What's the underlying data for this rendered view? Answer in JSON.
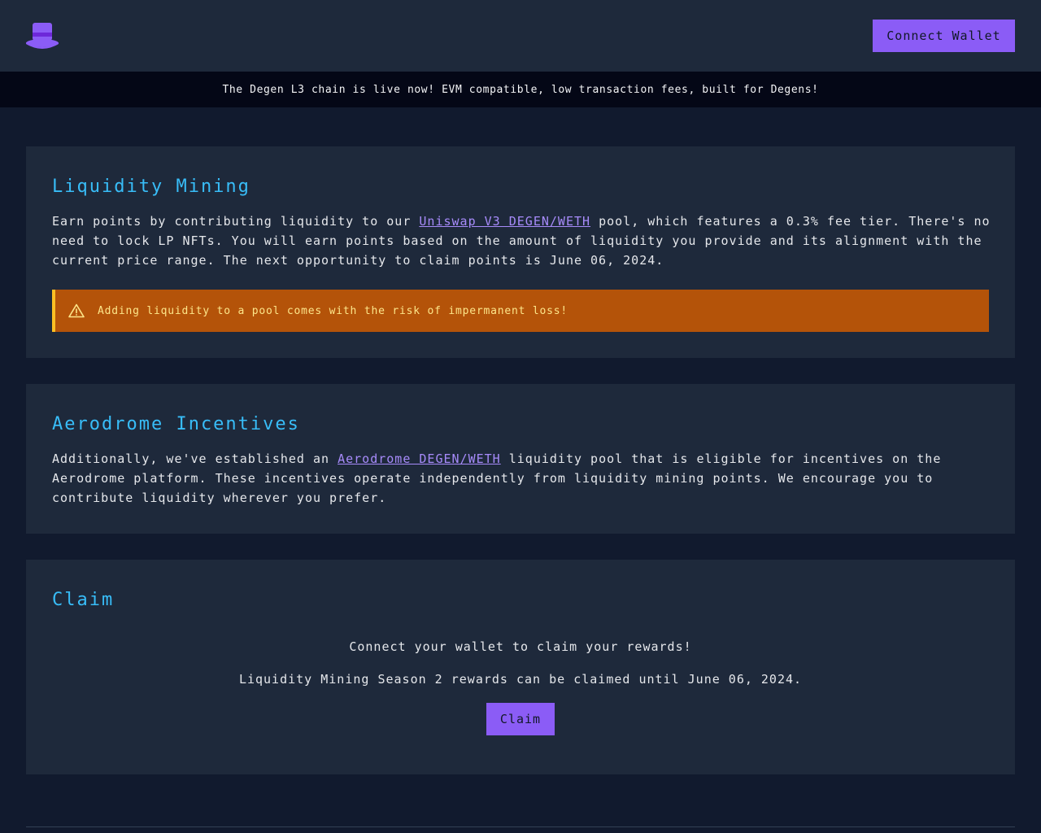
{
  "header": {
    "logo_icon": "top-hat-icon",
    "connect_label": "Connect Wallet"
  },
  "banner": {
    "text": "The Degen L3 chain is live now! EVM compatible, low transaction fees, built for Degens!"
  },
  "liquidity_mining": {
    "title": "Liquidity Mining",
    "text_before_link": "Earn points by contributing liquidity to our ",
    "link_label": "Uniswap V3 DEGEN/WETH",
    "text_after_link": " pool, which features a 0.3% fee tier. There's no need to lock LP NFTs. You will earn points based on the amount of liquidity you provide and its alignment with the current price range. The next opportunity to claim points is June 06, 2024.",
    "warning": {
      "icon": "warning-triangle-icon",
      "text": "Adding liquidity to a pool comes with the risk of impermanent loss!"
    }
  },
  "aerodrome": {
    "title": "Aerodrome Incentives",
    "text_before_link": "Additionally, we've established an ",
    "link_label": "Aerodrome DEGEN/WETH",
    "text_after_link": " liquidity pool that is eligible for incentives on the Aerodrome platform. These incentives operate independently from liquidity mining points. We encourage you to contribute liquidity wherever you prefer."
  },
  "claim": {
    "title": "Claim",
    "connect_prompt": "Connect your wallet to claim your rewards!",
    "season_note": "Liquidity Mining Season 2 rewards can be claimed until June 06, 2024.",
    "button_label": "Claim"
  },
  "colors": {
    "accent": "#8b5cf6",
    "heading": "#38bdf8",
    "warning_bg": "#b45309",
    "warning_border": "#fbbf24",
    "card_bg": "#1e293b",
    "page_bg": "#111a2e"
  }
}
